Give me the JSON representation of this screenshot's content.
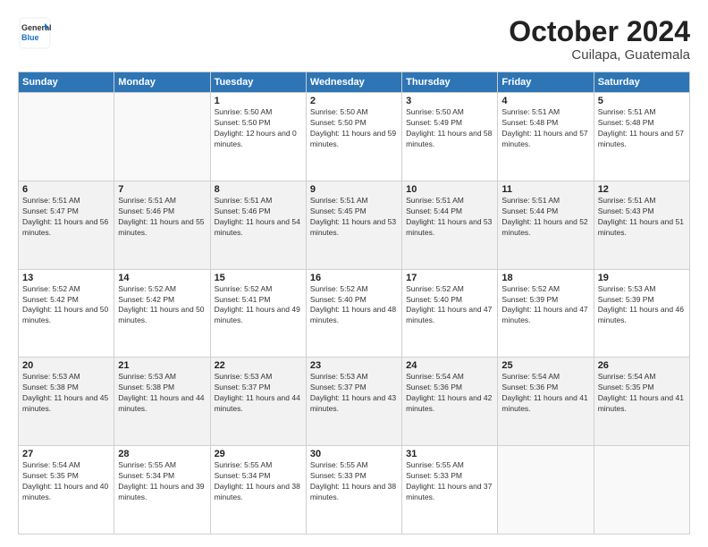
{
  "header": {
    "logo_line1": "General",
    "logo_line2": "Blue",
    "month": "October 2024",
    "location": "Cuilapa, Guatemala"
  },
  "weekdays": [
    "Sunday",
    "Monday",
    "Tuesday",
    "Wednesday",
    "Thursday",
    "Friday",
    "Saturday"
  ],
  "weeks": [
    [
      {
        "day": "",
        "empty": true
      },
      {
        "day": "",
        "empty": true
      },
      {
        "day": "1",
        "sunrise": "5:50 AM",
        "sunset": "5:50 PM",
        "daylight": "12 hours and 0 minutes."
      },
      {
        "day": "2",
        "sunrise": "5:50 AM",
        "sunset": "5:50 PM",
        "daylight": "11 hours and 59 minutes."
      },
      {
        "day": "3",
        "sunrise": "5:50 AM",
        "sunset": "5:49 PM",
        "daylight": "11 hours and 58 minutes."
      },
      {
        "day": "4",
        "sunrise": "5:51 AM",
        "sunset": "5:48 PM",
        "daylight": "11 hours and 57 minutes."
      },
      {
        "day": "5",
        "sunrise": "5:51 AM",
        "sunset": "5:48 PM",
        "daylight": "11 hours and 57 minutes."
      }
    ],
    [
      {
        "day": "6",
        "sunrise": "5:51 AM",
        "sunset": "5:47 PM",
        "daylight": "11 hours and 56 minutes."
      },
      {
        "day": "7",
        "sunrise": "5:51 AM",
        "sunset": "5:46 PM",
        "daylight": "11 hours and 55 minutes."
      },
      {
        "day": "8",
        "sunrise": "5:51 AM",
        "sunset": "5:46 PM",
        "daylight": "11 hours and 54 minutes."
      },
      {
        "day": "9",
        "sunrise": "5:51 AM",
        "sunset": "5:45 PM",
        "daylight": "11 hours and 53 minutes."
      },
      {
        "day": "10",
        "sunrise": "5:51 AM",
        "sunset": "5:44 PM",
        "daylight": "11 hours and 53 minutes."
      },
      {
        "day": "11",
        "sunrise": "5:51 AM",
        "sunset": "5:44 PM",
        "daylight": "11 hours and 52 minutes."
      },
      {
        "day": "12",
        "sunrise": "5:51 AM",
        "sunset": "5:43 PM",
        "daylight": "11 hours and 51 minutes."
      }
    ],
    [
      {
        "day": "13",
        "sunrise": "5:52 AM",
        "sunset": "5:42 PM",
        "daylight": "11 hours and 50 minutes."
      },
      {
        "day": "14",
        "sunrise": "5:52 AM",
        "sunset": "5:42 PM",
        "daylight": "11 hours and 50 minutes."
      },
      {
        "day": "15",
        "sunrise": "5:52 AM",
        "sunset": "5:41 PM",
        "daylight": "11 hours and 49 minutes."
      },
      {
        "day": "16",
        "sunrise": "5:52 AM",
        "sunset": "5:40 PM",
        "daylight": "11 hours and 48 minutes."
      },
      {
        "day": "17",
        "sunrise": "5:52 AM",
        "sunset": "5:40 PM",
        "daylight": "11 hours and 47 minutes."
      },
      {
        "day": "18",
        "sunrise": "5:52 AM",
        "sunset": "5:39 PM",
        "daylight": "11 hours and 47 minutes."
      },
      {
        "day": "19",
        "sunrise": "5:53 AM",
        "sunset": "5:39 PM",
        "daylight": "11 hours and 46 minutes."
      }
    ],
    [
      {
        "day": "20",
        "sunrise": "5:53 AM",
        "sunset": "5:38 PM",
        "daylight": "11 hours and 45 minutes."
      },
      {
        "day": "21",
        "sunrise": "5:53 AM",
        "sunset": "5:38 PM",
        "daylight": "11 hours and 44 minutes."
      },
      {
        "day": "22",
        "sunrise": "5:53 AM",
        "sunset": "5:37 PM",
        "daylight": "11 hours and 44 minutes."
      },
      {
        "day": "23",
        "sunrise": "5:53 AM",
        "sunset": "5:37 PM",
        "daylight": "11 hours and 43 minutes."
      },
      {
        "day": "24",
        "sunrise": "5:54 AM",
        "sunset": "5:36 PM",
        "daylight": "11 hours and 42 minutes."
      },
      {
        "day": "25",
        "sunrise": "5:54 AM",
        "sunset": "5:36 PM",
        "daylight": "11 hours and 41 minutes."
      },
      {
        "day": "26",
        "sunrise": "5:54 AM",
        "sunset": "5:35 PM",
        "daylight": "11 hours and 41 minutes."
      }
    ],
    [
      {
        "day": "27",
        "sunrise": "5:54 AM",
        "sunset": "5:35 PM",
        "daylight": "11 hours and 40 minutes."
      },
      {
        "day": "28",
        "sunrise": "5:55 AM",
        "sunset": "5:34 PM",
        "daylight": "11 hours and 39 minutes."
      },
      {
        "day": "29",
        "sunrise": "5:55 AM",
        "sunset": "5:34 PM",
        "daylight": "11 hours and 38 minutes."
      },
      {
        "day": "30",
        "sunrise": "5:55 AM",
        "sunset": "5:33 PM",
        "daylight": "11 hours and 38 minutes."
      },
      {
        "day": "31",
        "sunrise": "5:55 AM",
        "sunset": "5:33 PM",
        "daylight": "11 hours and 37 minutes."
      },
      {
        "day": "",
        "empty": true
      },
      {
        "day": "",
        "empty": true
      }
    ]
  ],
  "labels": {
    "sunrise": "Sunrise:",
    "sunset": "Sunset:",
    "daylight": "Daylight:"
  }
}
